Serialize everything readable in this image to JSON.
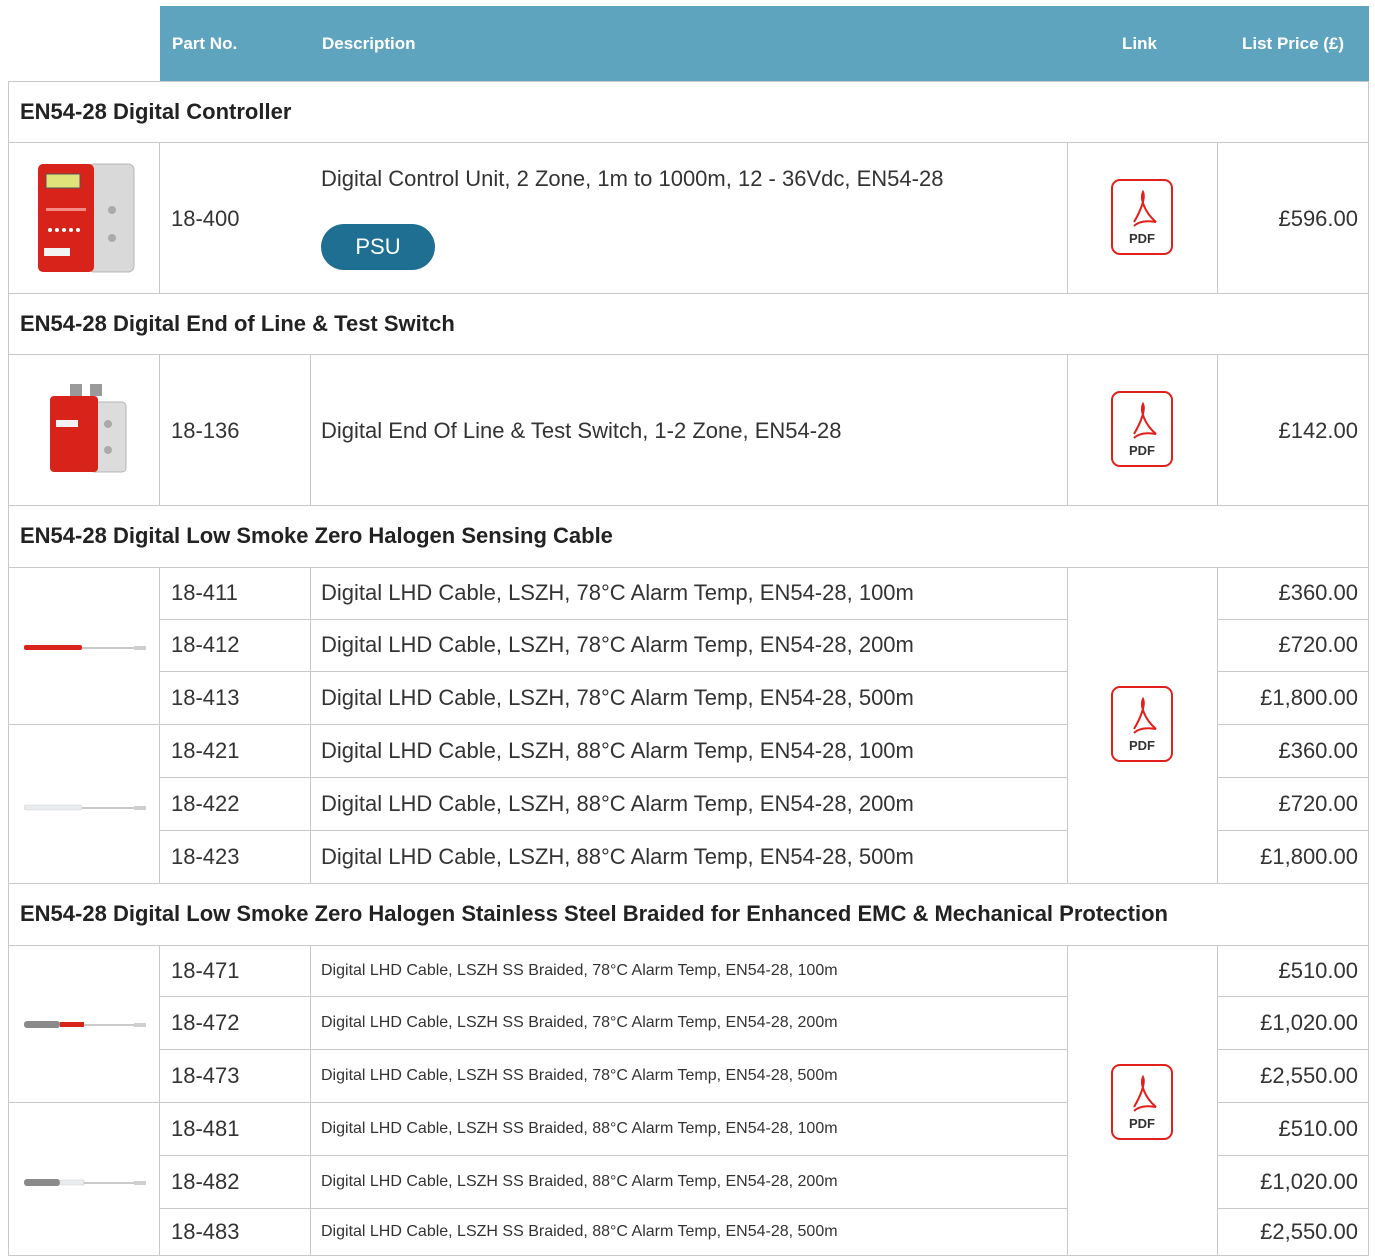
{
  "header": {
    "part_no": "Part No.",
    "description": "Description",
    "link": "Link",
    "list_price": "List Price (£)"
  },
  "sections": [
    {
      "title": "EN54-28 Digital Controller",
      "rows": [
        {
          "part": "18-400",
          "desc": "Digital Control Unit, 2 Zone, 1m to 1000m, 12 - 36Vdc, EN54-28",
          "price": "£596.00",
          "button": "PSU"
        }
      ]
    },
    {
      "title": "EN54-28 Digital End of Line & Test Switch",
      "rows": [
        {
          "part": "18-136",
          "desc": "Digital End Of Line & Test Switch, 1-2 Zone, EN54-28",
          "price": "£142.00"
        }
      ]
    },
    {
      "title": "EN54-28 Digital Low Smoke Zero Halogen Sensing Cable",
      "rows": [
        {
          "part": "18-411",
          "desc": "Digital LHD Cable, LSZH, 78°C Alarm Temp, EN54-28, 100m",
          "price": "£360.00"
        },
        {
          "part": "18-412",
          "desc": "Digital LHD Cable, LSZH, 78°C Alarm Temp, EN54-28, 200m",
          "price": "£720.00"
        },
        {
          "part": "18-413",
          "desc": "Digital LHD Cable, LSZH, 78°C Alarm Temp, EN54-28, 500m",
          "price": "£1,800.00"
        },
        {
          "part": "18-421",
          "desc": "Digital LHD Cable, LSZH, 88°C Alarm Temp, EN54-28, 100m",
          "price": "£360.00"
        },
        {
          "part": "18-422",
          "desc": "Digital LHD Cable, LSZH, 88°C Alarm Temp, EN54-28, 200m",
          "price": "£720.00"
        },
        {
          "part": "18-423",
          "desc": "Digital LHD Cable, LSZH, 88°C Alarm Temp, EN54-28, 500m",
          "price": "£1,800.00"
        }
      ]
    },
    {
      "title": "EN54-28 Digital Low Smoke Zero Halogen Stainless Steel Braided for Enhanced EMC & Mechanical Protection",
      "rows": [
        {
          "part": "18-471",
          "desc": "Digital LHD Cable, LSZH SS Braided, 78°C Alarm Temp, EN54-28, 100m",
          "price": "£510.00"
        },
        {
          "part": "18-472",
          "desc": "Digital LHD Cable, LSZH SS Braided, 78°C Alarm Temp, EN54-28, 200m",
          "price": "£1,020.00"
        },
        {
          "part": "18-473",
          "desc": "Digital LHD Cable, LSZH SS Braided, 78°C Alarm Temp, EN54-28, 500m",
          "price": "£2,550.00"
        },
        {
          "part": "18-481",
          "desc": "Digital LHD Cable, LSZH SS Braided, 88°C Alarm Temp, EN54-28, 100m",
          "price": "£510.00"
        },
        {
          "part": "18-482",
          "desc": "Digital LHD Cable, LSZH SS Braided, 88°C Alarm Temp, EN54-28, 200m",
          "price": "£1,020.00"
        },
        {
          "part": "18-483",
          "desc": "Digital LHD Cable, LSZH SS Braided, 88°C Alarm Temp, EN54-28, 500m",
          "price": "£2,550.00"
        }
      ]
    }
  ],
  "pdf_icon": {
    "label": "PDF",
    "icon": "pdf-icon"
  },
  "colors": {
    "header_bg": "#5ea4bf",
    "button_bg": "#1f6f93",
    "pdf_red": "#e2201b"
  }
}
